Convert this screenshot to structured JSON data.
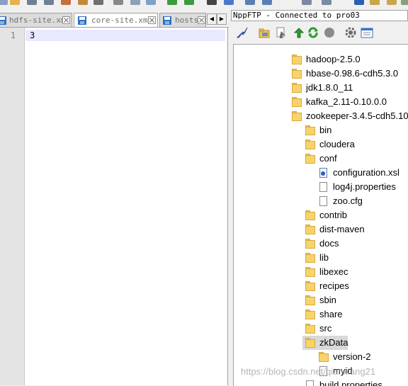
{
  "editor": {
    "tabs": [
      {
        "label": "hdfs-site.xml",
        "icon": "disk-icon"
      },
      {
        "label": "core-site.xml",
        "icon": "disk-icon"
      },
      {
        "label": "hosts",
        "icon": "disk-icon"
      }
    ],
    "line_number": "1",
    "content": "3"
  },
  "ftp": {
    "title": "NppFTP - Connected to pro03",
    "toolbar_icons": [
      "connect-icon",
      "open-folder-icon",
      "download-icon",
      "upload-icon",
      "refresh-icon",
      "abort-icon",
      "settings-icon",
      "message-window-icon"
    ],
    "tree": [
      {
        "label": "hadoop-2.5.0",
        "type": "folder"
      },
      {
        "label": "hbase-0.98.6-cdh5.3.0",
        "type": "folder"
      },
      {
        "label": "jdk1.8.0_11",
        "type": "folder"
      },
      {
        "label": "kafka_2.11-0.10.0.0",
        "type": "folder"
      },
      {
        "label": "zookeeper-3.4.5-cdh5.10",
        "type": "folder"
      },
      {
        "label": "bin",
        "type": "folder"
      },
      {
        "label": "cloudera",
        "type": "folder"
      },
      {
        "label": "conf",
        "type": "folder"
      },
      {
        "label": "configuration.xsl",
        "type": "xsl"
      },
      {
        "label": "log4j.properties",
        "type": "file"
      },
      {
        "label": "zoo.cfg",
        "type": "file"
      },
      {
        "label": "contrib",
        "type": "folder"
      },
      {
        "label": "dist-maven",
        "type": "folder"
      },
      {
        "label": "docs",
        "type": "folder"
      },
      {
        "label": "lib",
        "type": "folder"
      },
      {
        "label": "libexec",
        "type": "folder"
      },
      {
        "label": "recipes",
        "type": "folder"
      },
      {
        "label": "sbin",
        "type": "folder"
      },
      {
        "label": "share",
        "type": "folder"
      },
      {
        "label": "src",
        "type": "folder"
      },
      {
        "label": "zkData",
        "type": "folder",
        "selected": true
      },
      {
        "label": "version-2",
        "type": "folder"
      },
      {
        "label": "myid",
        "type": "file"
      },
      {
        "label": "build.properties",
        "type": "file"
      }
    ]
  },
  "watermark": "https://blog.csdn.net/qianxiang21"
}
